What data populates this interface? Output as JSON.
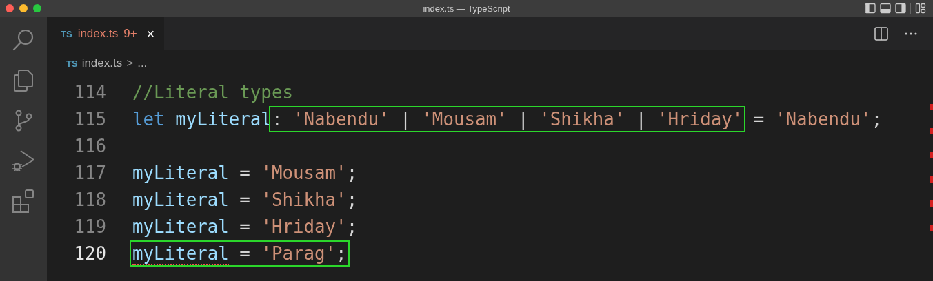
{
  "window": {
    "title": "index.ts — TypeScript"
  },
  "activity_bar": [
    {
      "kind": "search",
      "selected": false
    },
    {
      "kind": "explorer",
      "selected": false
    },
    {
      "kind": "source-control",
      "selected": false
    },
    {
      "kind": "run-debug",
      "selected": false
    },
    {
      "kind": "extensions",
      "selected": false
    }
  ],
  "tabs": [
    {
      "badge": "TS",
      "label": "index.ts",
      "problems": "9+",
      "close": "×",
      "selected": true
    }
  ],
  "breadcrumb": {
    "badge": "TS",
    "file": "index.ts",
    "separator": ">",
    "rest": "..."
  },
  "editor": {
    "lines": [
      {
        "number": "114",
        "active": false,
        "groups": [
          {
            "boxed": false,
            "tokens": [
              {
                "text": "//Literal types",
                "kind": "comment",
                "error": false
              }
            ]
          }
        ]
      },
      {
        "number": "115",
        "active": false,
        "groups": [
          {
            "boxed": false,
            "tokens": [
              {
                "text": "let ",
                "kind": "keyword",
                "error": false
              },
              {
                "text": "myLiteral",
                "kind": "variable",
                "error": false
              }
            ]
          },
          {
            "boxed": true,
            "tokens": [
              {
                "text": ": ",
                "kind": "punct",
                "error": false
              },
              {
                "text": "'Nabendu'",
                "kind": "string",
                "error": false
              },
              {
                "text": " | ",
                "kind": "punct",
                "error": false
              },
              {
                "text": "'Mousam'",
                "kind": "string",
                "error": false
              },
              {
                "text": " | ",
                "kind": "punct",
                "error": false
              },
              {
                "text": "'Shikha'",
                "kind": "string",
                "error": false
              },
              {
                "text": " | ",
                "kind": "punct",
                "error": false
              },
              {
                "text": "'Hriday'",
                "kind": "string",
                "error": false
              }
            ]
          },
          {
            "boxed": false,
            "tokens": [
              {
                "text": " = ",
                "kind": "punct",
                "error": false
              },
              {
                "text": "'Nabendu'",
                "kind": "string",
                "error": false
              },
              {
                "text": ";",
                "kind": "punct",
                "error": false
              }
            ]
          }
        ]
      },
      {
        "number": "116",
        "active": false
      },
      {
        "number": "117",
        "active": false,
        "groups": [
          {
            "boxed": false,
            "tokens": [
              {
                "text": "myLiteral",
                "kind": "variable",
                "error": false
              },
              {
                "text": " = ",
                "kind": "punct",
                "error": false
              },
              {
                "text": "'Mousam'",
                "kind": "string",
                "error": false
              },
              {
                "text": ";",
                "kind": "punct",
                "error": false
              }
            ]
          }
        ]
      },
      {
        "number": "118",
        "active": false,
        "groups": [
          {
            "boxed": false,
            "tokens": [
              {
                "text": "myLiteral",
                "kind": "variable",
                "error": false
              },
              {
                "text": " = ",
                "kind": "punct",
                "error": false
              },
              {
                "text": "'Shikha'",
                "kind": "string",
                "error": false
              },
              {
                "text": ";",
                "kind": "punct",
                "error": false
              }
            ]
          }
        ]
      },
      {
        "number": "119",
        "active": false,
        "groups": [
          {
            "boxed": false,
            "tokens": [
              {
                "text": "myLiteral",
                "kind": "variable",
                "error": false
              },
              {
                "text": " = ",
                "kind": "punct",
                "error": false
              },
              {
                "text": "'Hriday'",
                "kind": "string",
                "error": false
              },
              {
                "text": ";",
                "kind": "punct",
                "error": false
              }
            ]
          }
        ]
      },
      {
        "number": "120",
        "active": true,
        "groups": [
          {
            "boxed": true,
            "tokens": [
              {
                "text": "myLiteral",
                "kind": "variable",
                "error": true
              },
              {
                "text": " = ",
                "kind": "punct",
                "error": false
              },
              {
                "text": "'Parag'",
                "kind": "string",
                "error": false
              },
              {
                "text": ";",
                "kind": "punct",
                "error": false
              }
            ]
          }
        ]
      }
    ]
  }
}
